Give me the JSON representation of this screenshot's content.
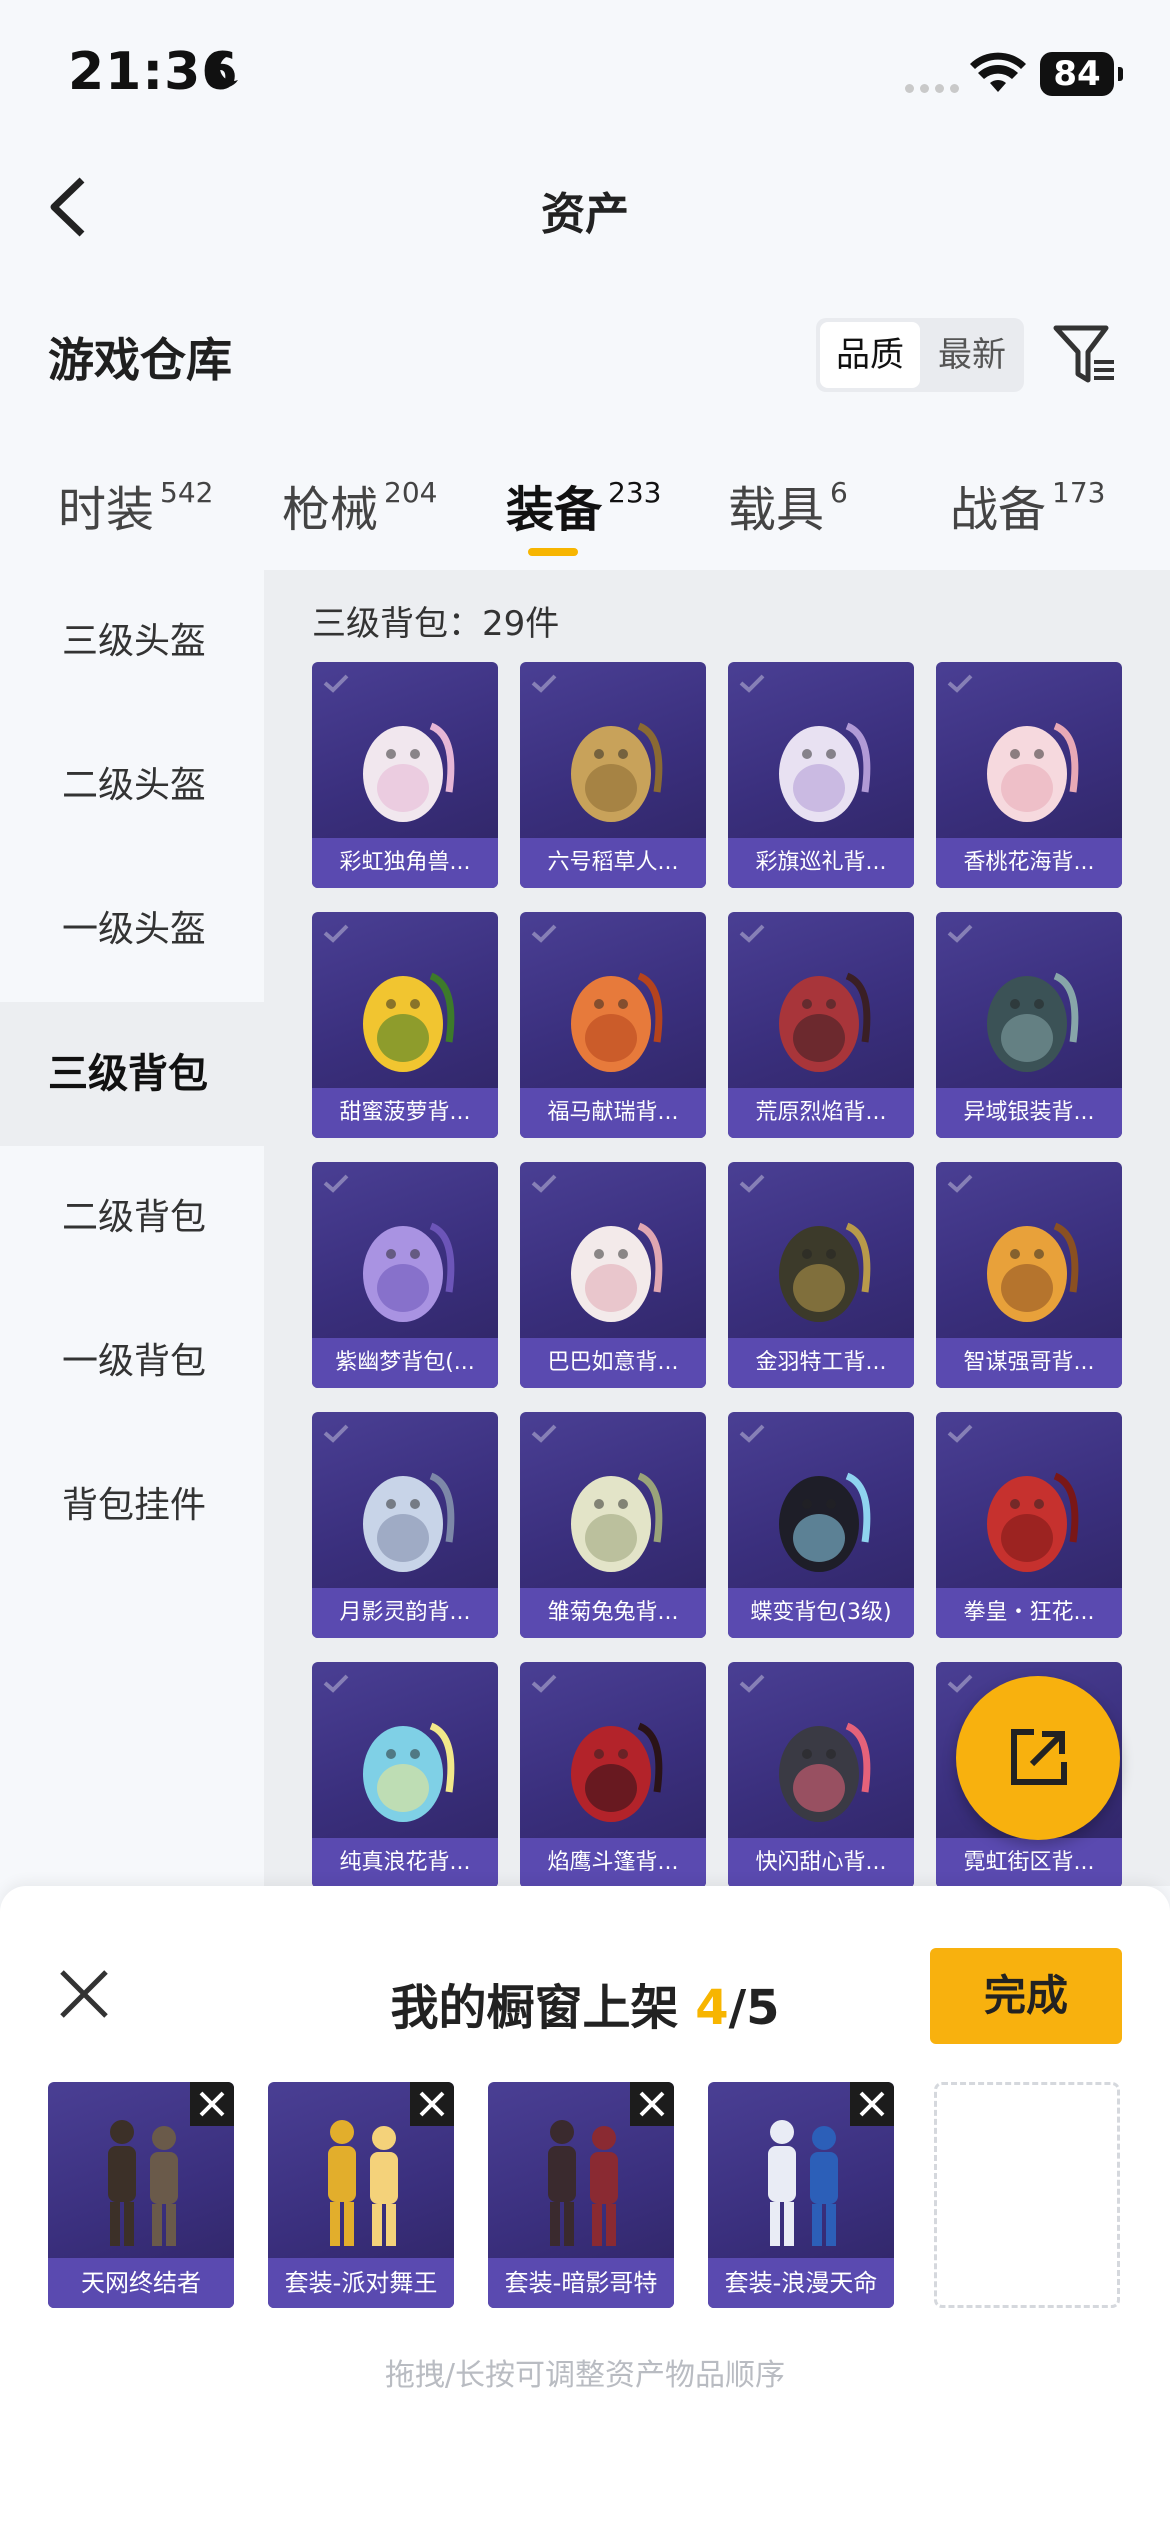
{
  "status_bar": {
    "time": "21:36",
    "battery": "84"
  },
  "nav": {
    "title": "资产"
  },
  "section": {
    "title": "游戏仓库"
  },
  "sort": {
    "quality": "品质",
    "newest": "最新"
  },
  "tabs": [
    {
      "label": "时装",
      "count": "542"
    },
    {
      "label": "枪械",
      "count": "204"
    },
    {
      "label": "装备",
      "count": "233"
    },
    {
      "label": "载具",
      "count": "6"
    },
    {
      "label": "战备",
      "count": "173"
    }
  ],
  "sidebar": {
    "items": [
      "三级头盔",
      "二级头盔",
      "一级头盔",
      "三级背包",
      "二级背包",
      "一级背包",
      "背包挂件"
    ]
  },
  "grid": {
    "caption": "三级背包：29件",
    "items": [
      "彩虹独角兽...",
      "六号稻草人...",
      "彩旗巡礼背...",
      "香桃花海背...",
      "甜蜜菠萝背...",
      "福马献瑞背...",
      "荒原烈焰背...",
      "异域银装背...",
      "紫幽梦背包(...",
      "巴巴如意背...",
      "金羽特工背...",
      "智谋强哥背...",
      "月影灵韵背...",
      "雏菊兔兔背...",
      "蝶变背包(3级)",
      "拳皇・狂花...",
      "纯真浪花背...",
      "焰鹰斗篷背...",
      "快闪甜心背...",
      "霓虹街区背..."
    ]
  },
  "sheet": {
    "title": "我的橱窗上架",
    "count_current": "4",
    "count_total": "/5",
    "done_label": "完成",
    "slots": [
      "天网终结者",
      "套装-派对舞王",
      "套装-暗影哥特",
      "套装-浪漫天命"
    ],
    "hint": "拖拽/长按可调整资产物品顺序"
  },
  "colors": {
    "accent": "#f8b10e",
    "card_bg": "#3a2f7d",
    "card_label": "#5a4ab0"
  }
}
